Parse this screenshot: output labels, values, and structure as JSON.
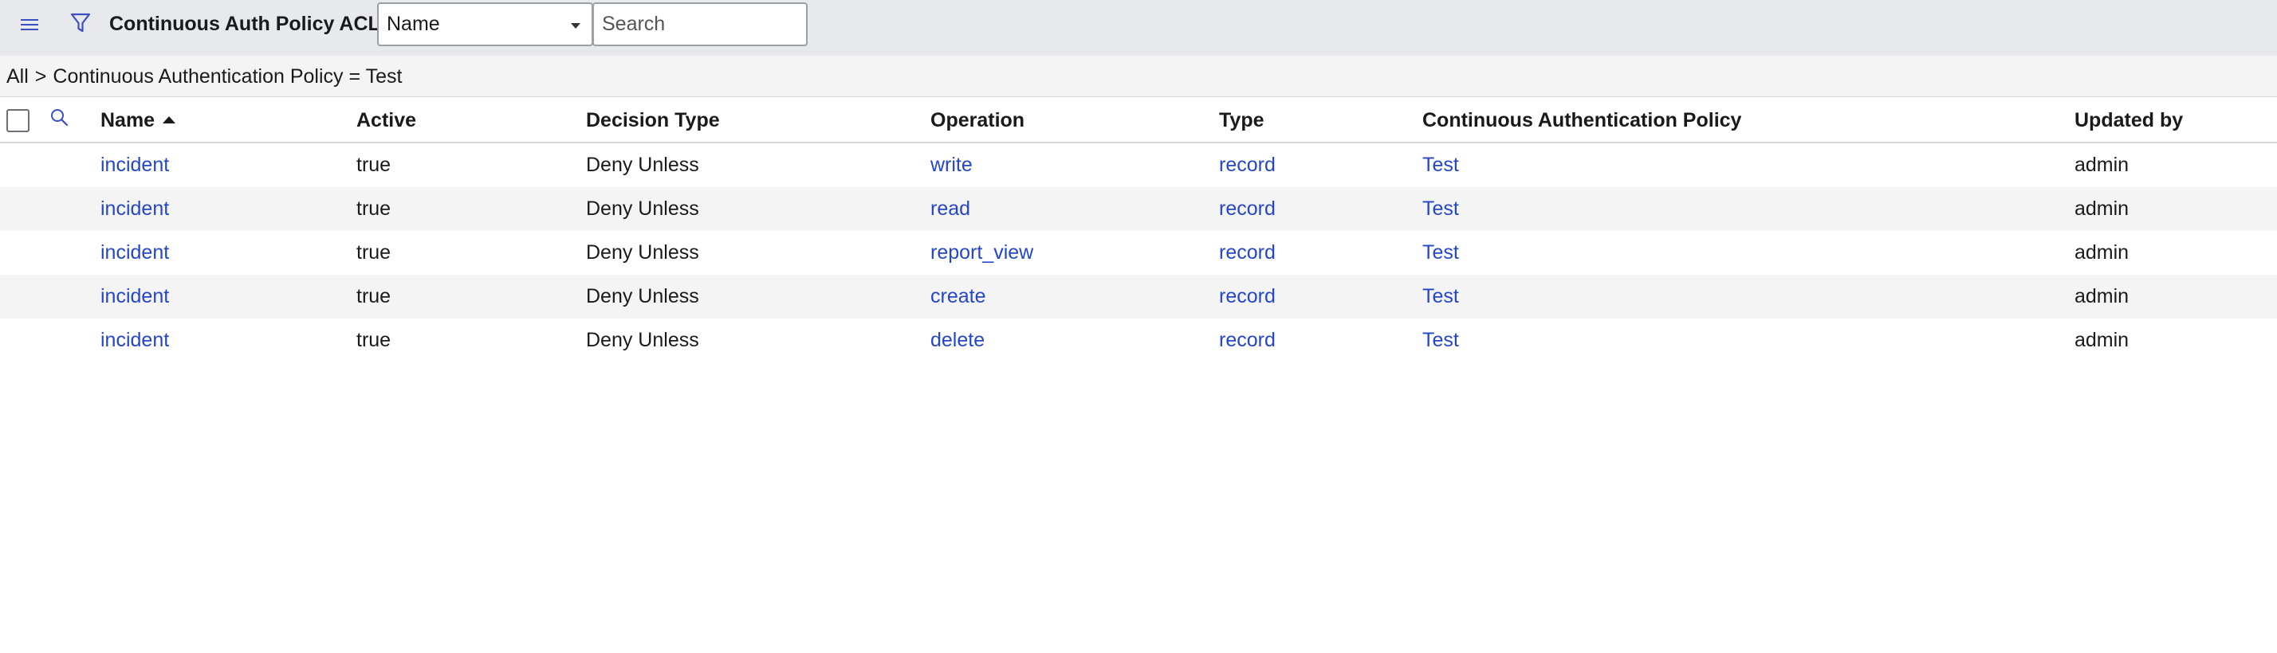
{
  "header": {
    "title": "Continuous Auth Policy ACLs",
    "field_select": {
      "selected": "Name"
    },
    "search": {
      "placeholder": "Search",
      "value": ""
    }
  },
  "breadcrumb": {
    "items": [
      "All",
      "Continuous Authentication Policy = Test"
    ],
    "separator": ">"
  },
  "table": {
    "columns": [
      "Name",
      "Active",
      "Decision Type",
      "Operation",
      "Type",
      "Continuous Authentication Policy",
      "Updated by"
    ],
    "sort": {
      "column": "Name",
      "direction": "ascending"
    },
    "rows": [
      {
        "name": "incident",
        "active": "true",
        "decision_type": "Deny Unless",
        "operation": "write",
        "type": "record",
        "policy": "Test",
        "updated_by": "admin"
      },
      {
        "name": "incident",
        "active": "true",
        "decision_type": "Deny Unless",
        "operation": "read",
        "type": "record",
        "policy": "Test",
        "updated_by": "admin"
      },
      {
        "name": "incident",
        "active": "true",
        "decision_type": "Deny Unless",
        "operation": "report_view",
        "type": "record",
        "policy": "Test",
        "updated_by": "admin"
      },
      {
        "name": "incident",
        "active": "true",
        "decision_type": "Deny Unless",
        "operation": "create",
        "type": "record",
        "policy": "Test",
        "updated_by": "admin"
      },
      {
        "name": "incident",
        "active": "true",
        "decision_type": "Deny Unless",
        "operation": "delete",
        "type": "record",
        "policy": "Test",
        "updated_by": "admin"
      }
    ]
  },
  "icons": {
    "menu": "hamburger-menu-icon",
    "filter": "filter-funnel-icon",
    "column_search": "magnifier-search-icon",
    "sort": "sort-ascending-arrow-icon",
    "select_caret": "caret-down-icon"
  },
  "colors": {
    "header_bg": "#e8e9ec",
    "breadcrumb_bg": "#f4f4f5",
    "link": "#2446c8",
    "icon": "#3b4fc4",
    "row_alt_bg": "#f4f4f5"
  }
}
